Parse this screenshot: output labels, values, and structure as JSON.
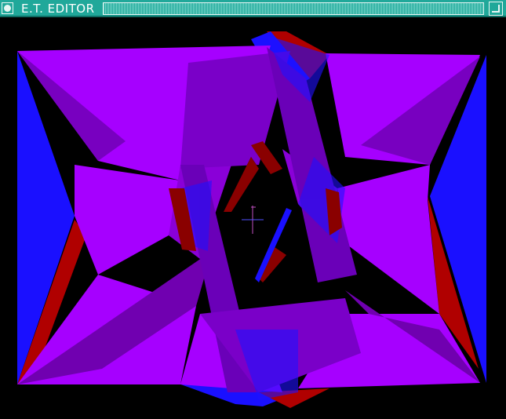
{
  "window": {
    "title": "E.T. EDITOR"
  },
  "colors": {
    "titlebar_bg": "#20a89a",
    "viewport_bg": "#000000",
    "magenta_face": "#a600ff",
    "blue_face": "#1a10ff",
    "red_face": "#b00000",
    "purple_face": "#6a00b8"
  },
  "icons": {
    "close": "circle-close-icon",
    "resize": "window-resize-icon",
    "cursor": "crosshair-cursor-icon"
  }
}
